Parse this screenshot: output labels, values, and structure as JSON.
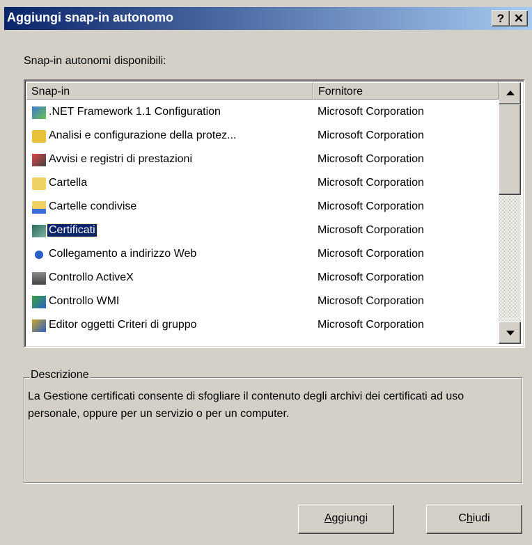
{
  "window": {
    "title": "Aggiungi snap-in autonomo",
    "help_glyph": "?",
    "close_glyph": "✕"
  },
  "available_label": "Snap-in autonomi disponibili:",
  "list": {
    "columns": [
      "Snap-in",
      "Fornitore"
    ],
    "rows": [
      {
        "name": ".NET Framework 1.1 Configuration",
        "vendor": "Microsoft Corporation",
        "icon": "net-config-icon"
      },
      {
        "name": "Analisi e configurazione della protez...",
        "vendor": "Microsoft Corporation",
        "icon": "security-analysis-icon"
      },
      {
        "name": "Avvisi e registri di prestazioni",
        "vendor": "Microsoft Corporation",
        "icon": "performance-logs-icon"
      },
      {
        "name": "Cartella",
        "vendor": "Microsoft Corporation",
        "icon": "folder-icon"
      },
      {
        "name": "Cartelle condivise",
        "vendor": "Microsoft Corporation",
        "icon": "shared-folders-icon"
      },
      {
        "name": "Certificati",
        "vendor": "Microsoft Corporation",
        "icon": "certificates-icon"
      },
      {
        "name": "Collegamento a indirizzo Web",
        "vendor": "Microsoft Corporation",
        "icon": "web-link-icon"
      },
      {
        "name": "Controllo ActiveX",
        "vendor": "Microsoft Corporation",
        "icon": "activex-icon"
      },
      {
        "name": "Controllo WMI",
        "vendor": "Microsoft Corporation",
        "icon": "wmi-control-icon"
      },
      {
        "name": "Editor oggetti Criteri di gruppo",
        "vendor": "Microsoft Corporation",
        "icon": "group-policy-icon"
      }
    ],
    "selected_index": 5
  },
  "description": {
    "legend": "Descrizione",
    "text": "La Gestione certificati consente di sfogliare il contenuto degli archivi dei certificati ad uso personale, oppure per un servizio o per un computer."
  },
  "buttons": {
    "add": {
      "label_ul": "A",
      "label_rest": "ggiungi"
    },
    "close": {
      "label_pre": "C",
      "label_ul": "h",
      "label_rest": "iudi"
    }
  },
  "colors": {
    "titlebar_start": "#0a246a",
    "titlebar_end": "#a6caf0",
    "selection": "#0a246a",
    "face": "#d4d0c8"
  }
}
